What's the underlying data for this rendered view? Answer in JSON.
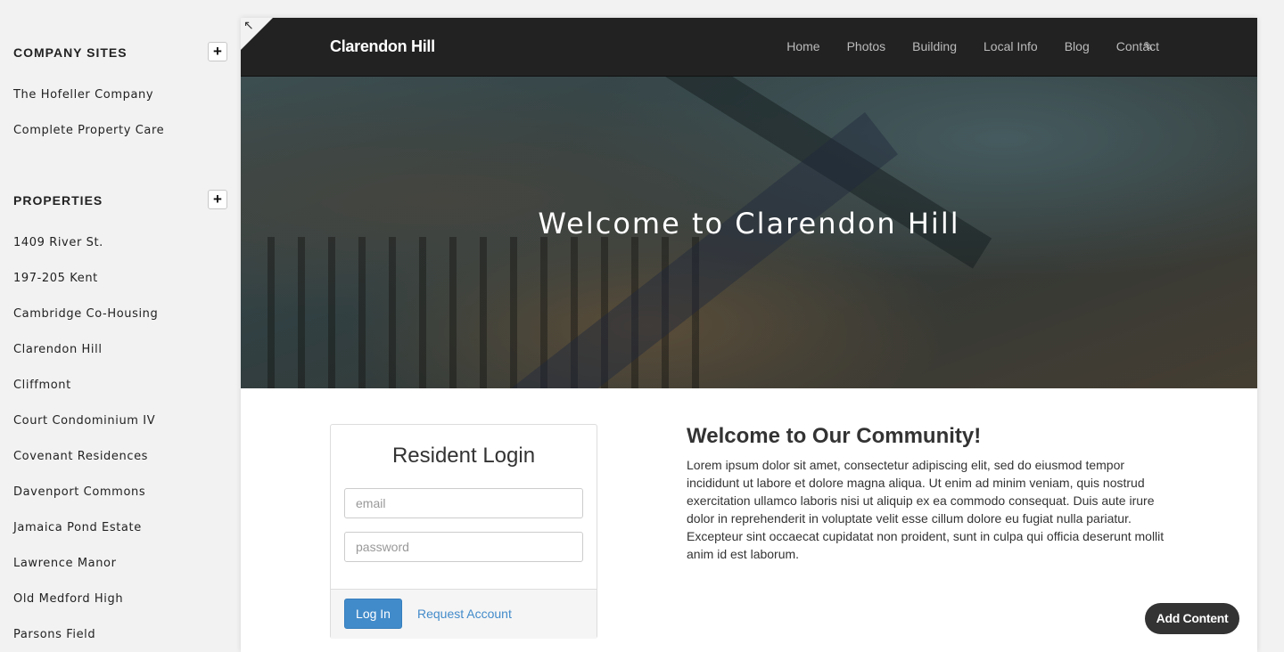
{
  "sidebar": {
    "company_sites": {
      "title": "COMPANY SITES",
      "add_label": "+",
      "items": [
        "The Hofeller Company",
        "Complete Property Care"
      ]
    },
    "properties": {
      "title": "PROPERTIES",
      "add_label": "+",
      "items": [
        "1409 River St.",
        "197-205 Kent",
        "Cambridge Co-Housing",
        "Clarendon Hill",
        "Cliffmont",
        "Court Condominium IV",
        "Covenant Residences",
        "Davenport Commons",
        "Jamaica Pond Estate",
        "Lawrence Manor",
        "Old Medford High",
        "Parsons Field"
      ]
    }
  },
  "header": {
    "corner_icon": "expand-arrow-icon",
    "brand": "Clarendon Hill",
    "nav": [
      "Home",
      "Photos",
      "Building",
      "Local Info",
      "Blog",
      "Contact"
    ],
    "edit_icon": "pencil-icon"
  },
  "hero": {
    "title": "Welcome to Clarendon Hill"
  },
  "login": {
    "title": "Resident Login",
    "email_placeholder": "email",
    "password_placeholder": "password",
    "login_button": "Log In",
    "request_link": "Request Account"
  },
  "content": {
    "heading": "Welcome to Our Community!",
    "body": "Lorem ipsum dolor sit amet, consectetur adipiscing elit, sed do eiusmod tempor incididunt ut labore et dolore magna aliqua. Ut enim ad minim veniam, quis nostrud exercitation ullamco laboris nisi ut aliquip ex ea commodo consequat. Duis aute irure dolor in reprehenderit in voluptate velit esse cillum dolore eu fugiat nulla pariatur. Excepteur sint occaecat cupidatat non proident, sunt in culpa qui officia deserunt mollit anim id est laborum."
  },
  "add_content_label": "Add Content",
  "colors": {
    "navbar": "#222222",
    "primary_button": "#428bca",
    "sidebar_bg": "#f2f2f2"
  }
}
